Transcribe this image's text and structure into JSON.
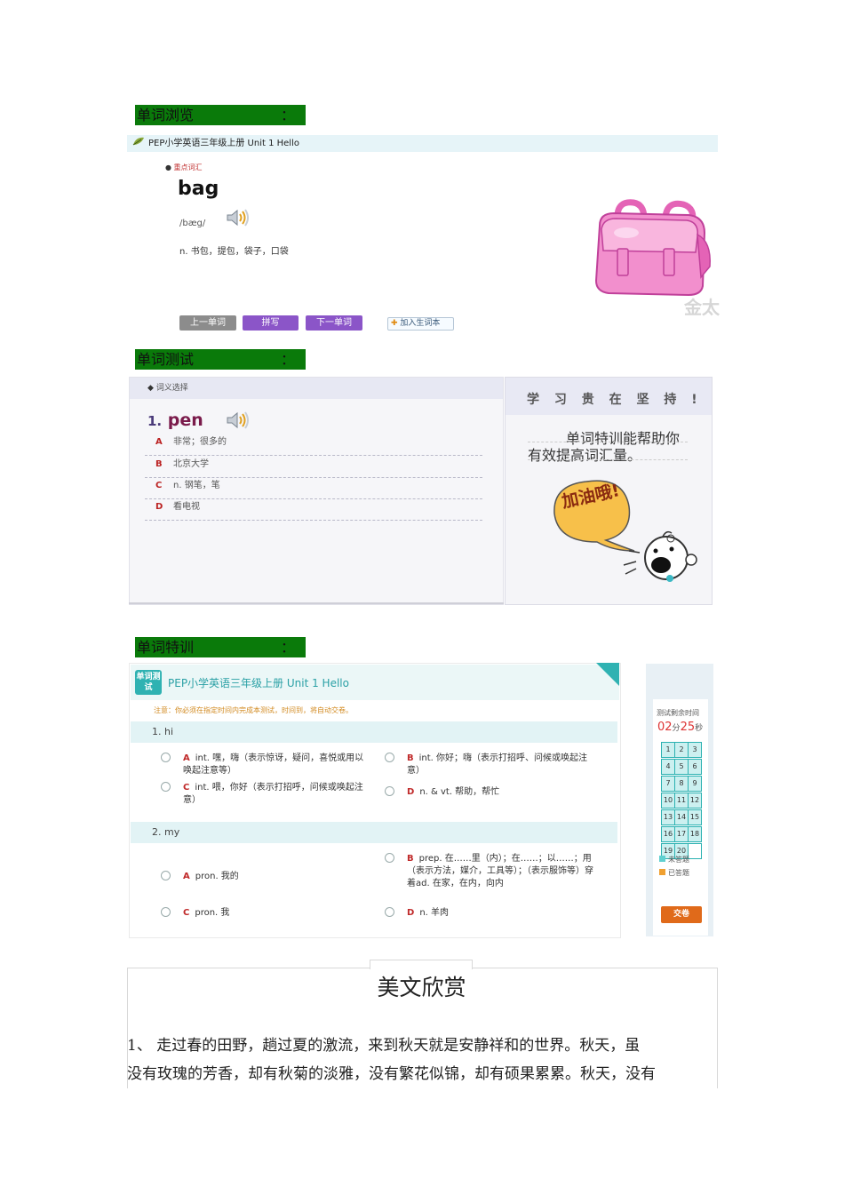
{
  "sections": {
    "s1": "单词浏览",
    "s2": "单词测试",
    "s3": "单词特训",
    "colon": "："
  },
  "browse": {
    "header": "PEP小学英语三年级上册  Unit 1 Hello",
    "tag": "重点词汇",
    "word": "bag",
    "phonetic": "/bæg/",
    "meaning": "n. 书包，提包，袋子，口袋",
    "buttons": {
      "prev": "上一单词",
      "spell": "拼写",
      "next": "下一单词",
      "add": "加入生词本"
    },
    "watermark": "金太"
  },
  "test": {
    "header": "词义选择",
    "qnum": "1.",
    "word": "pen",
    "options": [
      {
        "letter": "A",
        "text": "非常；很多的"
      },
      {
        "letter": "B",
        "text": "北京大学"
      },
      {
        "letter": "C",
        "text": "n. 钢笔，笔"
      },
      {
        "letter": "D",
        "text": "看电视"
      }
    ],
    "side_title": "学 习 贵 在 坚 持 !",
    "side_line1": "单词特训能帮助你",
    "side_line2": "有效提高词汇量。",
    "bubble": "加油哦!",
    "accent": "#7a1b4b"
  },
  "train": {
    "badge": "单词测试",
    "title": "PEP小学英语三年级上册 Unit 1 Hello",
    "note": "注意：你必须在指定时间内完成本测试，时间到，将自动交卷。",
    "q1": {
      "label": "1. hi",
      "A": "int. 嘿，嗨（表示惊讶，疑问，喜悦或用以唤起注意等）",
      "B": "int. 你好；嗨（表示打招呼、问候或唤起注意）",
      "C": "int. 喂，你好（表示打招呼，问候或唤起注意）",
      "D": "n. & vt. 帮助，帮忙"
    },
    "q2": {
      "label": "2. my",
      "A": "pron. 我的",
      "B": "prep. 在……里（内）；在……；以……；用（表示方法，媒介，工具等）；（表示服饰等）穿着ad. 在家，在内，向内",
      "C": "pron. 我",
      "D": "n. 羊肉"
    },
    "timer_label": "测试剩余时间",
    "timer_min": "02",
    "timer_min_unit": "分",
    "timer_sec": "25",
    "timer_sec_unit": "秒",
    "grid": [
      "1",
      "2",
      "3",
      "4",
      "5",
      "6",
      "7",
      "8",
      "9",
      "10",
      "11",
      "12",
      "13",
      "14",
      "15",
      "16",
      "17",
      "18",
      "19",
      "20",
      ""
    ],
    "legend_unanswered": "未答题",
    "legend_answered": "已答题",
    "submit": "交卷",
    "accent": "#2aa0a5"
  },
  "essay": {
    "title": "美文欣赏",
    "line1": "1、   走过春的田野，趟过夏的激流，来到秋天就是安静祥和的世界。秋天，虽",
    "line2": "没有玫瑰的芳香，却有秋菊的淡雅，没有繁花似锦，却有硕果累累。秋天，没有"
  }
}
